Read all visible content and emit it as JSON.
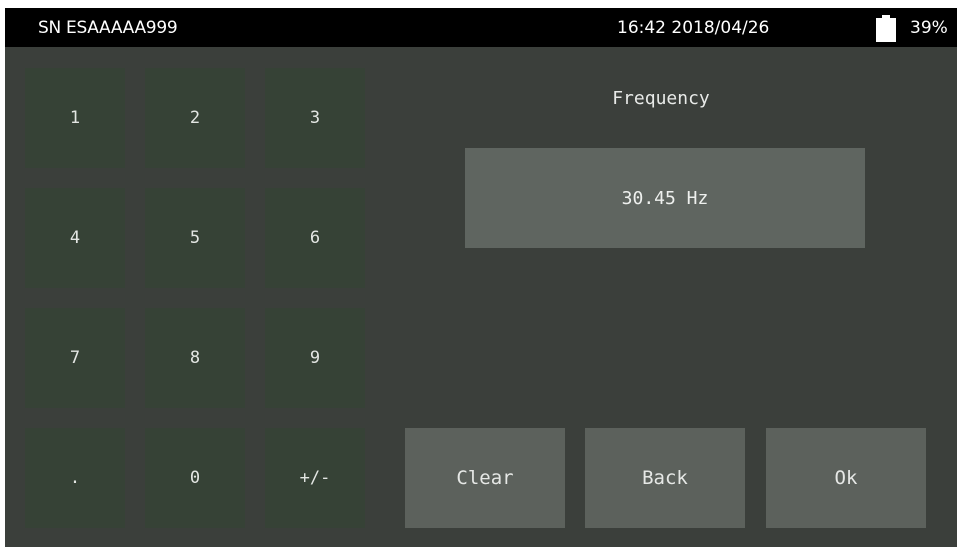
{
  "status_bar": {
    "serial": "SN ESAAAAA999",
    "clock": "16:42 2018/04/26",
    "battery_percent": "39%",
    "battery_icon": "battery-icon"
  },
  "keypad": {
    "keys": [
      "1",
      "2",
      "3",
      "4",
      "5",
      "6",
      "7",
      "8",
      "9",
      ".",
      "0",
      "+/-"
    ]
  },
  "entry": {
    "label": "Frequency",
    "value": "30.45 Hz"
  },
  "actions": {
    "clear": "Clear",
    "back": "Back",
    "ok": "Ok"
  },
  "colors": {
    "status_bar_bg": "#000000",
    "panel_bg": "#3b3f3b",
    "key_bg": "#364236",
    "display_bg": "#5f6560",
    "action_bg": "#5c615c"
  }
}
